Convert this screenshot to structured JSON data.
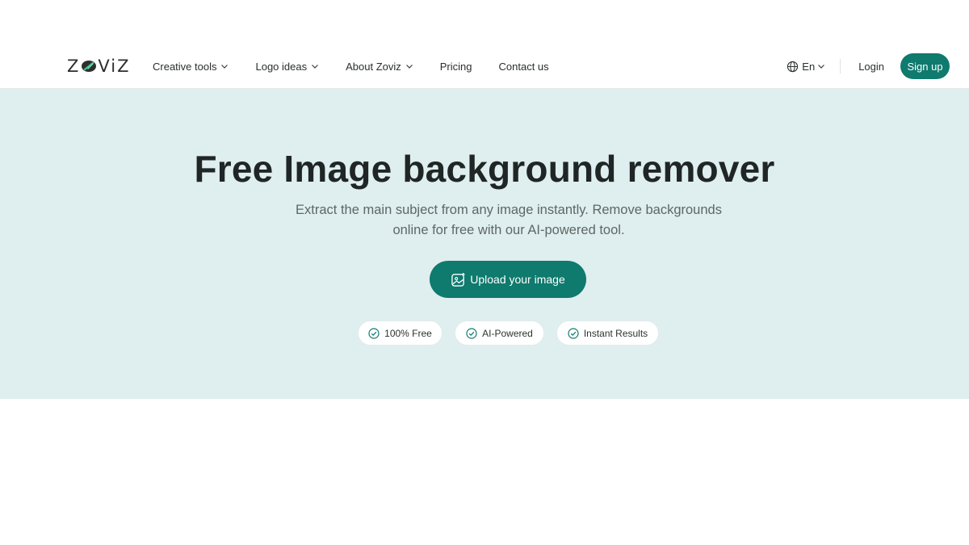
{
  "brand": {
    "logo_text_left": "Z",
    "logo_text_right": "ViZ",
    "accent_color": "#0f7a6e",
    "hero_bg": "#dfeeee"
  },
  "nav": {
    "items": [
      {
        "label": "Creative tools",
        "has_dropdown": true
      },
      {
        "label": "Logo ideas",
        "has_dropdown": true
      },
      {
        "label": "About Zoviz",
        "has_dropdown": true
      },
      {
        "label": "Pricing",
        "has_dropdown": false
      },
      {
        "label": "Contact us",
        "has_dropdown": false
      }
    ],
    "language": "En",
    "login_label": "Login",
    "signup_label": "Sign up"
  },
  "hero": {
    "title": "Free Image background remover",
    "subtitle_line1": "Extract the main subject from any image instantly. Remove backgrounds",
    "subtitle_line2": "online for free with our AI-powered tool.",
    "upload_label": "Upload your image",
    "badges": [
      "100% Free",
      "AI-Powered",
      "Instant Results"
    ]
  },
  "icons": [
    "globe-icon",
    "chevron-down-icon",
    "upload-image-icon",
    "check-circle-icon"
  ]
}
